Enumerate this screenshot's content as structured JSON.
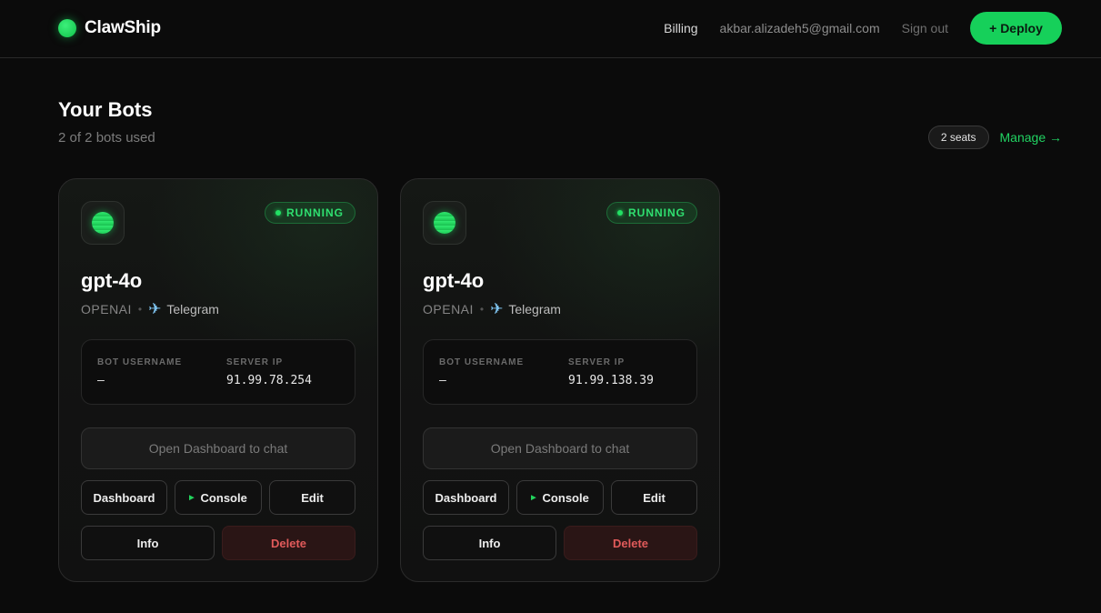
{
  "header": {
    "brand_name": "ClawShip",
    "billing_label": "Billing",
    "user_email": "akbar.alizadeh5@gmail.com",
    "signout_label": "Sign out",
    "deploy_label": "+ Deploy"
  },
  "page": {
    "title": "Your Bots",
    "usage_text": "2 of 2 bots used",
    "seats_label": "2 seats",
    "manage_label": "Manage →"
  },
  "bots": [
    {
      "status": "RUNNING",
      "model": "gpt-4o",
      "provider": "OPENAI",
      "channel": "Telegram",
      "channel_icon": "airplane-icon",
      "bot_username_label": "BOT USERNAME",
      "bot_username": "—",
      "server_ip_label": "SERVER IP",
      "server_ip": "91.99.78.254",
      "open_dashboard_label": "Open Dashboard to chat",
      "dashboard_label": "Dashboard",
      "console_label": "Console",
      "edit_label": "Edit",
      "info_label": "Info",
      "delete_label": "Delete"
    },
    {
      "status": "RUNNING",
      "model": "gpt-4o",
      "provider": "OPENAI",
      "channel": "Telegram",
      "channel_icon": "airplane-icon",
      "bot_username_label": "BOT USERNAME",
      "bot_username": "—",
      "server_ip_label": "SERVER IP",
      "server_ip": "91.99.138.39",
      "open_dashboard_label": "Open Dashboard to chat",
      "dashboard_label": "Dashboard",
      "console_label": "Console",
      "edit_label": "Edit",
      "info_label": "Info",
      "delete_label": "Delete"
    }
  ],
  "colors": {
    "accent": "#16d05a",
    "background": "#0b0b0b",
    "danger": "#e05a5a"
  }
}
